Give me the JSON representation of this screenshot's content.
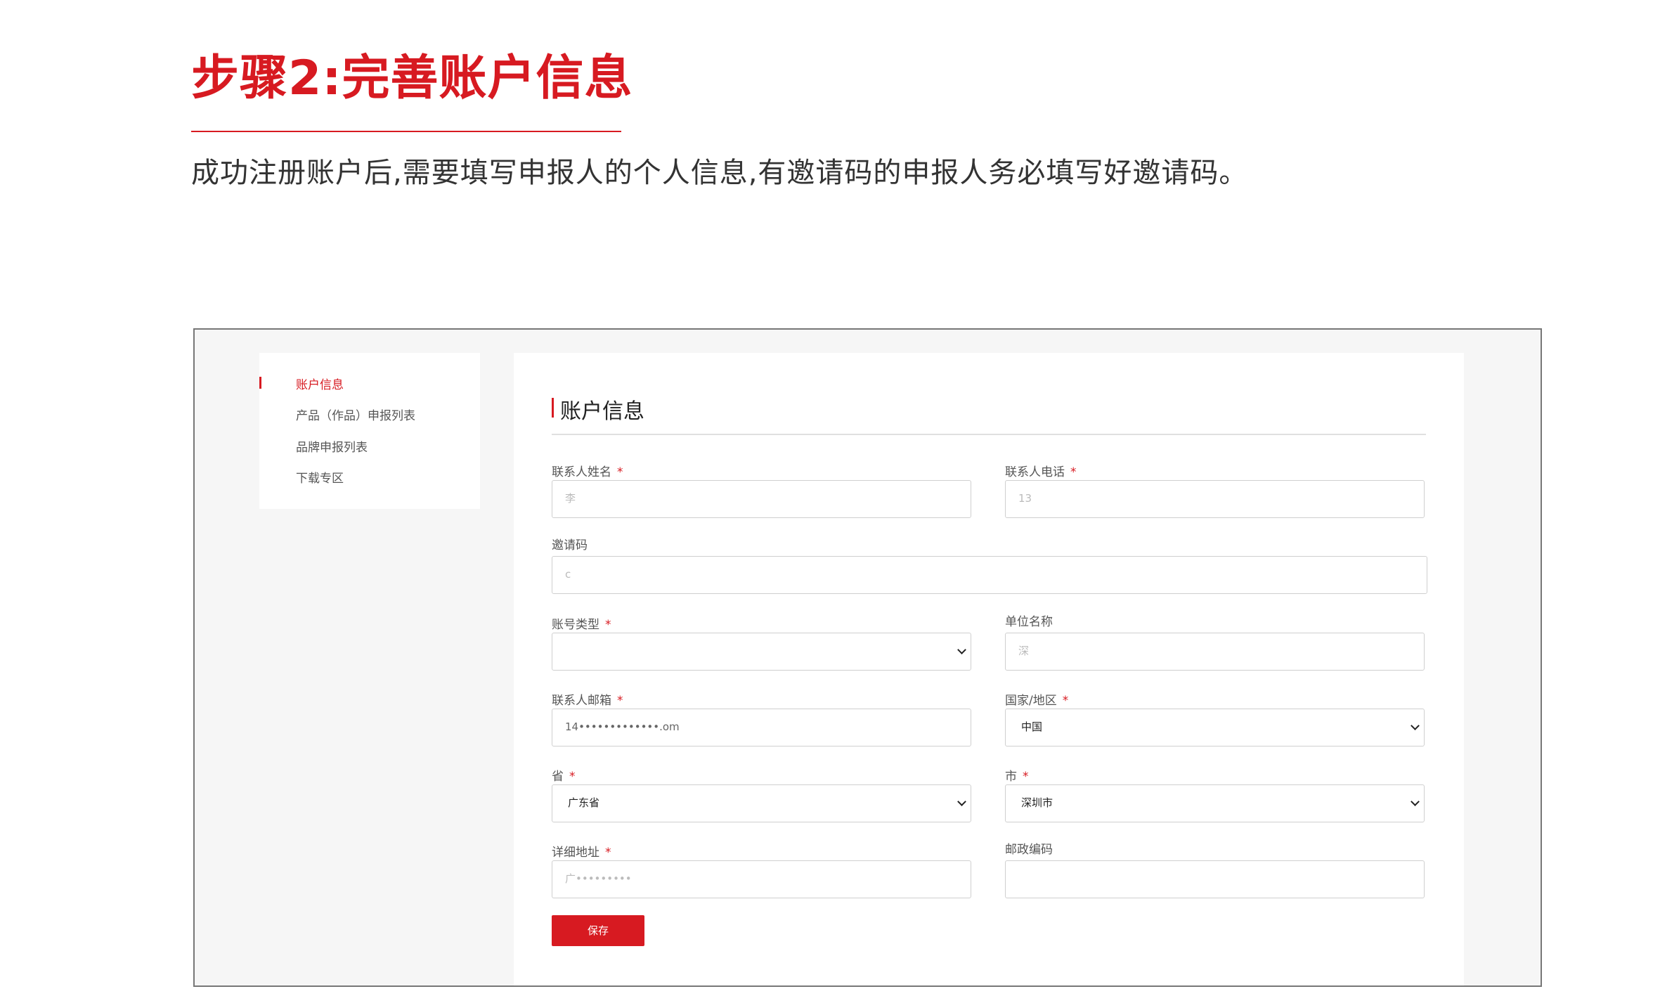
{
  "header": {
    "step_title": "步骤2:完善账户信息",
    "description": "成功注册账户后,需要填写申报人的个人信息,有邀请码的申报人务必填写好邀请码。"
  },
  "sidebar": {
    "items": [
      {
        "label": "账户信息",
        "active": true
      },
      {
        "label": "产品（作品）申报列表",
        "active": false
      },
      {
        "label": "品牌申报列表",
        "active": false
      },
      {
        "label": "下载专区",
        "active": false
      }
    ]
  },
  "form": {
    "section_title": "账户信息",
    "required_mark": "*",
    "fields": {
      "contact_name": {
        "label": "联系人姓名",
        "value": "李"
      },
      "contact_phone": {
        "label": "联系人电话",
        "value": "13"
      },
      "invite_code": {
        "label": "邀请码",
        "value": "c"
      },
      "account_type": {
        "label": "账号类型",
        "value": ""
      },
      "company_name": {
        "label": "单位名称",
        "value": "深"
      },
      "contact_email": {
        "label": "联系人邮箱",
        "value": "14•••••••••••••.om"
      },
      "country": {
        "label": "国家/地区",
        "value": "中国"
      },
      "province": {
        "label": "省",
        "value": "广东省"
      },
      "city": {
        "label": "市",
        "value": "深圳市"
      },
      "address": {
        "label": "详细地址",
        "value": "广•••••••••"
      },
      "postal_code": {
        "label": "邮政编码",
        "value": ""
      }
    },
    "save_label": "保存"
  },
  "colors": {
    "accent": "#d71a21",
    "frame_bg": "#f6f6f6",
    "border": "#cfcfcf"
  }
}
